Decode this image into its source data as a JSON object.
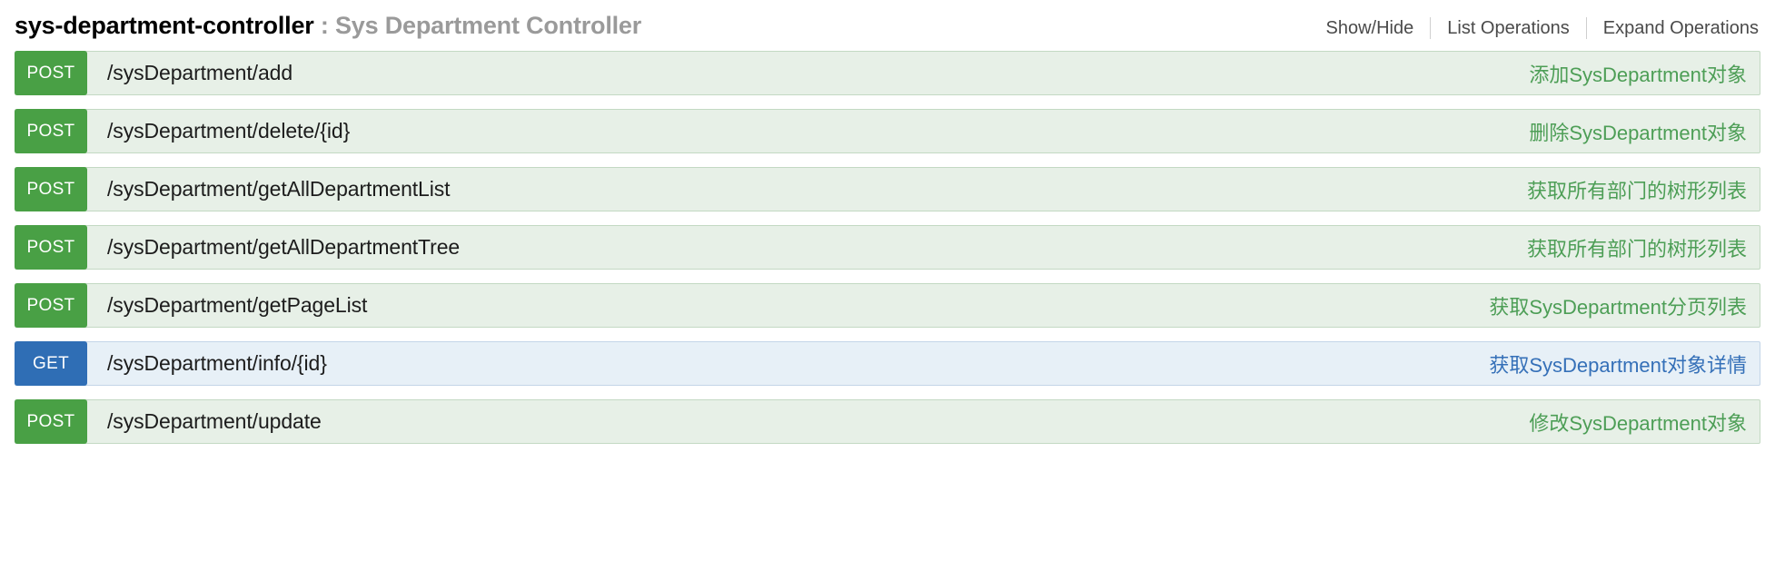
{
  "header": {
    "tag_name": "sys-department-controller",
    "separator": " : ",
    "tag_description": "Sys Department Controller",
    "options": [
      {
        "label": "Show/Hide",
        "name": "show-hide"
      },
      {
        "label": "List Operations",
        "name": "list-operations"
      },
      {
        "label": "Expand Operations",
        "name": "expand-operations"
      }
    ]
  },
  "colors": {
    "post_badge": "#49a045",
    "post_row_bg": "#e7f0e7",
    "post_row_border": "#c3d9c3",
    "post_text": "#4d9e56",
    "get_badge": "#2f6eb5",
    "get_row_bg": "#e7f0f7",
    "get_row_border": "#c3d5e8",
    "get_text": "#3570b8",
    "title": "#000000",
    "title_muted": "#9a9a9a",
    "option_link": "#4a4a4a"
  },
  "endpoints": [
    {
      "method": "POST",
      "path": "/sysDepartment/add",
      "description": "添加SysDepartment对象"
    },
    {
      "method": "POST",
      "path": "/sysDepartment/delete/{id}",
      "description": "删除SysDepartment对象"
    },
    {
      "method": "POST",
      "path": "/sysDepartment/getAllDepartmentList",
      "description": "获取所有部门的树形列表"
    },
    {
      "method": "POST",
      "path": "/sysDepartment/getAllDepartmentTree",
      "description": "获取所有部门的树形列表"
    },
    {
      "method": "POST",
      "path": "/sysDepartment/getPageList",
      "description": "获取SysDepartment分页列表"
    },
    {
      "method": "GET",
      "path": "/sysDepartment/info/{id}",
      "description": "获取SysDepartment对象详情"
    },
    {
      "method": "POST",
      "path": "/sysDepartment/update",
      "description": "修改SysDepartment对象"
    }
  ]
}
